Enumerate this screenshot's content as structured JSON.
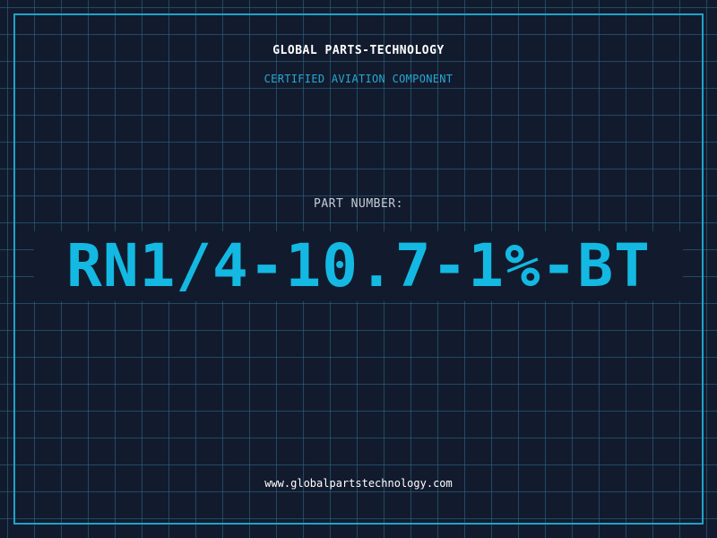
{
  "header": {
    "company": "GLOBAL PARTS-TECHNOLOGY",
    "subtitle": "CERTIFIED AVIATION COMPONENT"
  },
  "part": {
    "label": "PART NUMBER:",
    "number": "RN1/4-10.7-1%-BT"
  },
  "footer": {
    "website": "www.globalpartstechnology.com"
  },
  "colors": {
    "background": "#121b2e",
    "grid": "#306e8c",
    "frame": "#1fa3c7",
    "accent": "#13b9e2",
    "subtitle": "#27a8d3",
    "label": "#c5ccd6",
    "text": "#ffffff"
  }
}
